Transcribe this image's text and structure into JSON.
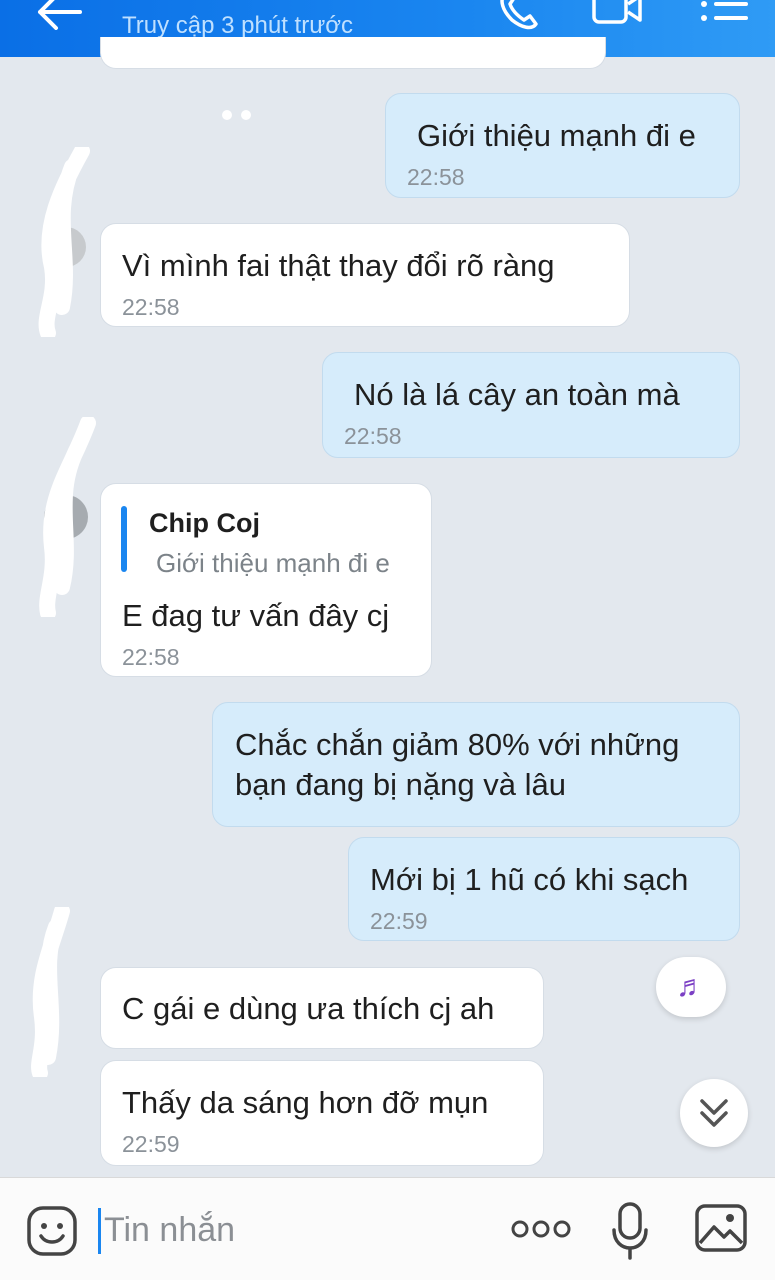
{
  "header": {
    "status": "Truy cập 3 phút trước"
  },
  "messages": [
    {
      "dir": "out",
      "text": "Giới thiệu mạnh đi e",
      "time": "22:58"
    },
    {
      "dir": "in",
      "text": "Vì mình fai thật thay đổi rõ ràng",
      "time": "22:58"
    },
    {
      "dir": "out",
      "text": "Nó là lá cây an toàn mà",
      "time": "22:58"
    },
    {
      "dir": "in",
      "quote_name": "Chip Coj",
      "quote_text": "Giới thiệu mạnh đi e",
      "text": "E đag tư vấn đây cj",
      "time": "22:58"
    },
    {
      "dir": "out",
      "line1": "Chắc chắn giảm 80% với những",
      "line2": "bạn đang bị nặng và lâu"
    },
    {
      "dir": "out",
      "text": "Mới bị 1 hũ có khi sạch",
      "time": "22:59"
    },
    {
      "dir": "in",
      "text": "C gái e dùng ưa thích cj ah"
    },
    {
      "dir": "in",
      "text": "Thấy da sáng hơn đỡ mụn",
      "time": "22:59"
    }
  ],
  "input": {
    "placeholder": "Tin nhắn"
  },
  "icons": {
    "back": "back-arrow-icon",
    "phone": "phone-icon",
    "video": "video-call-icon",
    "menu": "menu-icon",
    "music": "music-note-icon",
    "scroll_down": "double-chevron-down-icon",
    "emoji": "emoji-icon",
    "more": "more-icon",
    "mic": "microphone-icon",
    "image": "image-icon"
  },
  "colors": {
    "header": "#1a86f0",
    "outgoing_bubble": "#d6ecfb",
    "incoming_bubble": "#ffffff",
    "background": "#e3e8ee"
  }
}
